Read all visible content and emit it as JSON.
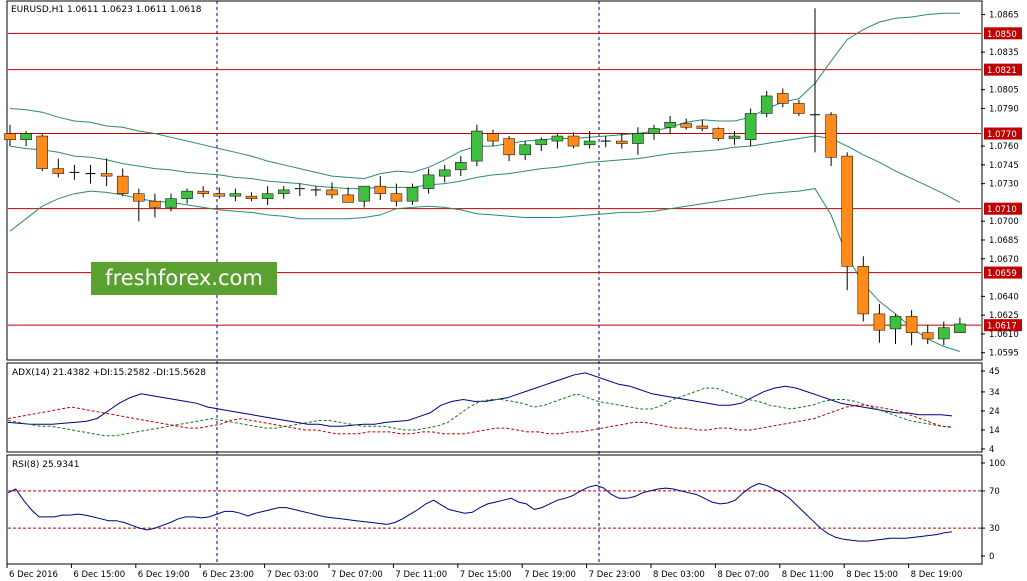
{
  "header": {
    "title": "EURUSD,H1  1.0611 1.0623 1.0611 1.0618"
  },
  "watermark": {
    "text": "freshforex.com"
  },
  "colors": {
    "bull": "#3fbf3f",
    "bear": "#ff8c1a",
    "level": "#c00000",
    "band": "#2e8b6b",
    "adx": "#000080",
    "pdi": "#1a7a1a",
    "mdi": "#c00000",
    "rsi": "#000080"
  },
  "chart_data": [
    {
      "type": "candlestick",
      "title": "EURUSD,H1  1.0611 1.0623 1.0611 1.0618",
      "ylim": [
        1.059,
        1.0875
      ],
      "y_ticks": [
        "1.0865",
        "1.0850",
        "1.0835",
        "1.0821",
        "1.0805",
        "1.0790",
        "1.0770",
        "1.0760",
        "1.0745",
        "1.0730",
        "1.0710",
        "1.0700",
        "1.0685",
        "1.0670",
        "1.0659",
        "1.0640",
        "1.0625",
        "1.0617",
        "1.0610",
        "1.0595"
      ],
      "highlight_ticks": [
        "1.0850",
        "1.0821",
        "1.0770",
        "1.0710",
        "1.0659",
        "1.0617"
      ],
      "levels": [
        1.085,
        1.0821,
        1.077,
        1.071,
        1.0659,
        1.0617
      ],
      "x_ticks": [
        "6 Dec 2016",
        "6 Dec 15:00",
        "6 Dec 19:00",
        "6 Dec 23:00",
        "7 Dec 03:00",
        "7 Dec 07:00",
        "7 Dec 11:00",
        "7 Dec 15:00",
        "7 Dec 19:00",
        "7 Dec 23:00",
        "8 Dec 03:00",
        "8 Dec 07:00",
        "8 Dec 11:00",
        "8 Dec 15:00",
        "8 Dec 19:00"
      ],
      "ohlc": [
        [
          1.077,
          1.0777,
          1.076,
          1.0765
        ],
        [
          1.0765,
          1.0772,
          1.076,
          1.077
        ],
        [
          1.0768,
          1.077,
          1.074,
          1.0742
        ],
        [
          1.0742,
          1.075,
          1.0735,
          1.0738
        ],
        [
          1.0738,
          1.0745,
          1.0733,
          1.0739
        ],
        [
          1.0738,
          1.0745,
          1.073,
          1.0737
        ],
        [
          1.0738,
          1.075,
          1.0728,
          1.0736
        ],
        [
          1.0736,
          1.0742,
          1.072,
          1.0722
        ],
        [
          1.0722,
          1.0726,
          1.07,
          1.0716
        ],
        [
          1.0716,
          1.0722,
          1.0703,
          1.0711
        ],
        [
          1.0711,
          1.0722,
          1.0708,
          1.0718
        ],
        [
          1.0718,
          1.0726,
          1.0714,
          1.0724
        ],
        [
          1.0724,
          1.0728,
          1.0719,
          1.0722
        ],
        [
          1.0722,
          1.0727,
          1.0718,
          1.072
        ],
        [
          1.072,
          1.0726,
          1.0716,
          1.0722
        ],
        [
          1.072,
          1.0723,
          1.0716,
          1.0718
        ],
        [
          1.0718,
          1.0728,
          1.0713,
          1.0722
        ],
        [
          1.0722,
          1.0728,
          1.0718,
          1.0725
        ],
        [
          1.0725,
          1.073,
          1.072,
          1.0726
        ],
        [
          1.0725,
          1.0728,
          1.072,
          1.0724
        ],
        [
          1.0725,
          1.0731,
          1.0718,
          1.0721
        ],
        [
          1.0721,
          1.0727,
          1.0715,
          1.0715
        ],
        [
          1.0716,
          1.0728,
          1.0711,
          1.0728
        ],
        [
          1.0728,
          1.0736,
          1.0717,
          1.0722
        ],
        [
          1.0722,
          1.073,
          1.0712,
          1.0716
        ],
        [
          1.0716,
          1.073,
          1.0713,
          1.0727
        ],
        [
          1.0726,
          1.0742,
          1.0722,
          1.0737
        ],
        [
          1.0736,
          1.0745,
          1.0731,
          1.0741
        ],
        [
          1.0741,
          1.0752,
          1.0736,
          1.0747
        ],
        [
          1.0748,
          1.0777,
          1.0744,
          1.0772
        ],
        [
          1.077,
          1.0773,
          1.076,
          1.0764
        ],
        [
          1.0766,
          1.0768,
          1.0748,
          1.0753
        ],
        [
          1.0753,
          1.0764,
          1.0749,
          1.0761
        ],
        [
          1.0761,
          1.0767,
          1.0756,
          1.0765
        ],
        [
          1.0764,
          1.077,
          1.0758,
          1.0768
        ],
        [
          1.0768,
          1.0771,
          1.0758,
          1.076
        ],
        [
          1.0761,
          1.0772,
          1.0758,
          1.0764
        ],
        [
          1.0764,
          1.0768,
          1.0759,
          1.0764
        ],
        [
          1.0764,
          1.077,
          1.0758,
          1.0762
        ],
        [
          1.0762,
          1.0775,
          1.0753,
          1.077
        ],
        [
          1.077,
          1.0777,
          1.0765,
          1.0774
        ],
        [
          1.0775,
          1.0784,
          1.077,
          1.0779
        ],
        [
          1.0778,
          1.0782,
          1.0773,
          1.0775
        ],
        [
          1.0776,
          1.0781,
          1.0772,
          1.0774
        ],
        [
          1.0774,
          1.0775,
          1.0764,
          1.0766
        ],
        [
          1.0766,
          1.0772,
          1.0761,
          1.0768
        ],
        [
          1.0765,
          1.079,
          1.076,
          1.0786
        ],
        [
          1.0786,
          1.0804,
          1.0783,
          1.08
        ],
        [
          1.0802,
          1.0806,
          1.0791,
          1.0794
        ],
        [
          1.0794,
          1.0797,
          1.0784,
          1.0786
        ],
        [
          1.0785,
          1.087,
          1.0755,
          1.0784
        ],
        [
          1.0785,
          1.0787,
          1.0744,
          1.0751
        ],
        [
          1.0752,
          1.0755,
          1.0645,
          1.0664
        ],
        [
          1.0664,
          1.0672,
          1.062,
          1.0626
        ],
        [
          1.0626,
          1.0634,
          1.0603,
          1.0613
        ],
        [
          1.0614,
          1.0626,
          1.0602,
          1.0624
        ],
        [
          1.0624,
          1.0629,
          1.0601,
          1.0611
        ],
        [
          1.0611,
          1.0617,
          1.0602,
          1.0606
        ],
        [
          1.0606,
          1.062,
          1.0601,
          1.0615
        ],
        [
          1.0611,
          1.0623,
          1.0611,
          1.0618
        ]
      ],
      "bollinger": {
        "upper": [
          1.079,
          1.0789,
          1.0787,
          1.0783,
          1.078,
          1.0779,
          1.0776,
          1.0775,
          1.0772,
          1.077,
          1.0767,
          1.0764,
          1.0761,
          1.0758,
          1.0755,
          1.0752,
          1.0748,
          1.0745,
          1.0742,
          1.0739,
          1.0736,
          1.0735,
          1.0734,
          1.0738,
          1.074,
          1.0739,
          1.0743,
          1.0749,
          1.0756,
          1.076,
          1.076,
          1.0762,
          1.0764,
          1.0765,
          1.0766,
          1.0766,
          1.0767,
          1.0768,
          1.0769,
          1.077,
          1.0772,
          1.0775,
          1.0779,
          1.0781,
          1.078,
          1.078,
          1.0783,
          1.079,
          1.0795,
          1.0798,
          1.081,
          1.0828,
          1.0845,
          1.0853,
          1.0859,
          1.0862,
          1.0863,
          1.0865,
          1.0866,
          1.0866
        ],
        "middle": [
          1.076,
          1.0758,
          1.0757,
          1.0755,
          1.0752,
          1.0751,
          1.0749,
          1.0746,
          1.0744,
          1.0742,
          1.0741,
          1.0739,
          1.0738,
          1.0737,
          1.0735,
          1.0734,
          1.0732,
          1.0731,
          1.073,
          1.0728,
          1.0727,
          1.0726,
          1.0726,
          1.0727,
          1.0727,
          1.0727,
          1.0729,
          1.073,
          1.0732,
          1.0735,
          1.0737,
          1.0738,
          1.074,
          1.0742,
          1.0743,
          1.0745,
          1.0747,
          1.0748,
          1.0749,
          1.075,
          1.0752,
          1.0754,
          1.0755,
          1.0756,
          1.0757,
          1.0759,
          1.076,
          1.0762,
          1.0764,
          1.0766,
          1.0768,
          1.0766,
          1.076,
          1.0753,
          1.0747,
          1.074,
          1.0734,
          1.0728,
          1.0722,
          1.0715
        ],
        "lower": [
          1.0692,
          1.0702,
          1.0712,
          1.0718,
          1.0722,
          1.0724,
          1.0723,
          1.0721,
          1.0718,
          1.0716,
          1.0715,
          1.0713,
          1.0711,
          1.0709,
          1.0708,
          1.0707,
          1.0705,
          1.0704,
          1.0702,
          1.0702,
          1.0702,
          1.0702,
          1.0703,
          1.0705,
          1.071,
          1.0711,
          1.0712,
          1.0711,
          1.0709,
          1.0706,
          1.0705,
          1.0704,
          1.0703,
          1.0703,
          1.0703,
          1.0704,
          1.0705,
          1.0706,
          1.0707,
          1.0707,
          1.0708,
          1.071,
          1.0712,
          1.0714,
          1.0716,
          1.0718,
          1.072,
          1.0722,
          1.0723,
          1.0724,
          1.0726,
          1.0705,
          1.0672,
          1.065,
          1.0636,
          1.0626,
          1.0615,
          1.0606,
          1.06,
          1.0596
        ]
      }
    },
    {
      "type": "line",
      "title": "ADX(14) 21.4382 +DI:15.2582 -DI:15.5628",
      "ylim": [
        4,
        45
      ],
      "y_ticks": [
        "45",
        "34",
        "24",
        "14",
        "4"
      ],
      "series": [
        {
          "name": "ADX",
          "values": [
            18,
            17.5,
            17,
            17,
            17,
            17.5,
            18,
            18.5,
            20,
            24,
            28,
            31,
            33,
            32,
            31,
            30,
            29,
            28,
            26,
            25,
            24,
            23,
            22,
            21,
            20,
            19,
            18,
            17,
            17,
            16,
            16,
            16.5,
            17,
            17,
            18,
            18.5,
            19,
            21,
            23,
            27,
            29,
            30,
            29,
            29,
            30,
            31,
            33,
            35,
            37,
            39,
            41,
            43,
            44,
            42,
            40,
            38,
            37,
            35,
            33,
            32,
            31,
            30,
            29,
            28,
            27,
            27,
            28,
            31,
            34,
            36,
            37,
            36,
            34,
            32,
            30,
            28,
            27,
            26,
            25,
            24,
            23,
            23,
            22,
            22,
            22,
            21.4
          ]
        },
        {
          "name": "+DI",
          "values": [
            19,
            18,
            17,
            16,
            16,
            15,
            14,
            13,
            12,
            11,
            11,
            12,
            13,
            14,
            15,
            16,
            17,
            18,
            19,
            20,
            19,
            18,
            17,
            16,
            15,
            15,
            16,
            17,
            18,
            19,
            19,
            18,
            17,
            16,
            16,
            16,
            15,
            14,
            14,
            15,
            16,
            18,
            22,
            26,
            29,
            30,
            30,
            29,
            28,
            26,
            27,
            29,
            31,
            33,
            31,
            29,
            28,
            27,
            26,
            25,
            25,
            27,
            30,
            32,
            34,
            36,
            36,
            34,
            32,
            30,
            29,
            27,
            26,
            25,
            26,
            27,
            29,
            30,
            30,
            29,
            27,
            25,
            23,
            21,
            19,
            18,
            17,
            16,
            15.3
          ]
        },
        {
          "name": "-DI",
          "values": [
            20,
            21,
            22,
            23,
            24,
            25,
            26,
            25,
            24,
            23,
            22,
            21,
            20,
            19,
            18,
            17,
            16,
            15,
            15,
            16,
            17,
            19,
            20,
            19,
            18,
            17,
            16,
            15,
            14,
            14,
            13,
            12,
            12,
            12,
            13,
            13,
            13,
            12,
            12,
            13,
            13,
            12,
            12,
            12,
            13,
            14,
            15,
            15,
            14,
            13,
            13,
            12,
            12,
            13,
            13,
            14,
            15,
            16,
            17,
            18,
            18,
            17,
            16,
            15,
            15,
            14,
            14,
            15,
            15,
            14,
            14,
            15,
            16,
            17,
            18,
            19,
            20,
            22,
            24,
            26,
            27,
            27,
            26,
            25,
            24,
            22,
            20,
            18,
            16,
            15.6
          ]
        }
      ]
    },
    {
      "type": "line",
      "title": "RSI(8) 25.9341",
      "ylim": [
        0,
        100
      ],
      "y_ticks": [
        "100",
        "70",
        "30",
        "0"
      ],
      "levels": [
        70,
        30
      ],
      "series": [
        {
          "name": "RSI",
          "values": [
            68,
            72,
            60,
            50,
            42,
            42,
            42,
            44,
            44,
            45,
            44,
            42,
            40,
            38,
            38,
            36,
            33,
            30,
            28,
            30,
            33,
            36,
            40,
            42,
            42,
            41,
            42,
            45,
            48,
            48,
            46,
            43,
            46,
            48,
            50,
            52,
            52,
            50,
            48,
            46,
            44,
            42,
            41,
            40,
            39,
            38,
            37,
            36,
            35,
            34,
            36,
            40,
            45,
            50,
            56,
            60,
            55,
            50,
            48,
            46,
            47,
            52,
            56,
            58,
            60,
            62,
            58,
            56,
            50,
            52,
            56,
            60,
            62,
            65,
            70,
            74,
            76,
            73,
            66,
            62,
            62,
            64,
            68,
            70,
            72,
            73,
            72,
            70,
            68,
            66,
            62,
            58,
            56,
            57,
            60,
            68,
            74,
            78,
            76,
            72,
            68,
            62,
            54,
            46,
            38,
            30,
            24,
            20,
            18,
            17,
            16,
            16,
            17,
            18,
            19,
            19,
            19,
            20,
            21,
            22,
            23,
            25,
            25.9
          ]
        }
      ]
    }
  ]
}
